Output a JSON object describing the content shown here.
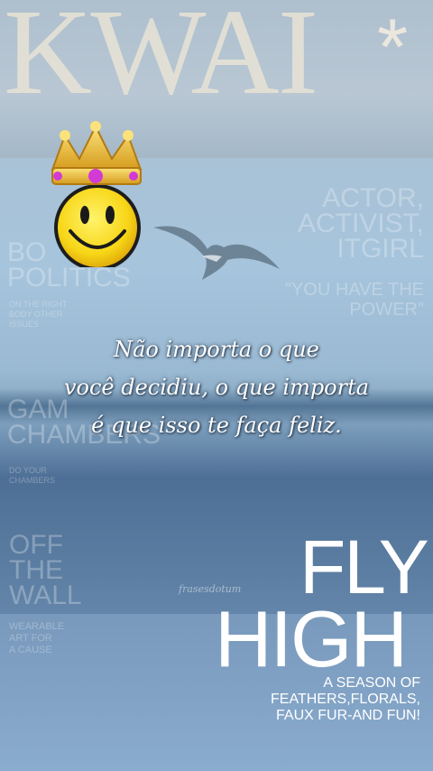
{
  "brand": {
    "logo_text": "KWAI",
    "logo_mark": "*"
  },
  "magazine_left": {
    "headline1": [
      "BO",
      "POLITICS"
    ],
    "sub1": [
      "ON THE RIGHT",
      "BODY OTHER",
      "ISSUES"
    ],
    "headline2": [
      "GAM",
      "CHAMBERS"
    ],
    "sub2": [
      "DO YOUR",
      "CHAMBERS"
    ],
    "headline3": [
      "OFF",
      "THE",
      "WALL"
    ],
    "sub3": [
      "WEARABLE",
      "ART FOR",
      "A CAUSE"
    ]
  },
  "magazine_right": {
    "headline": [
      "ACTOR,",
      "ACTIVIST,",
      "ITGIRL"
    ],
    "quote": [
      "\"YOU HAVE THE",
      "POWER\""
    ]
  },
  "quote": {
    "lines": [
      "Não importa o que",
      "você decidiu, o que importa",
      "é que isso te faça feliz."
    ]
  },
  "signature": "frasesdotum",
  "cover_title": {
    "line1": "FLY",
    "line2": "HIGH"
  },
  "cover_subtitle": [
    "A SEASON OF",
    "FEATHERS,FLORALS,",
    "FAUX FUR-AND FUN!"
  ],
  "sticker": {
    "icon": "crown-smiley-icon"
  },
  "colors": {
    "sky": "#a6c4dc",
    "sea": "#4e6f95",
    "logo": "#e9e4d6"
  }
}
